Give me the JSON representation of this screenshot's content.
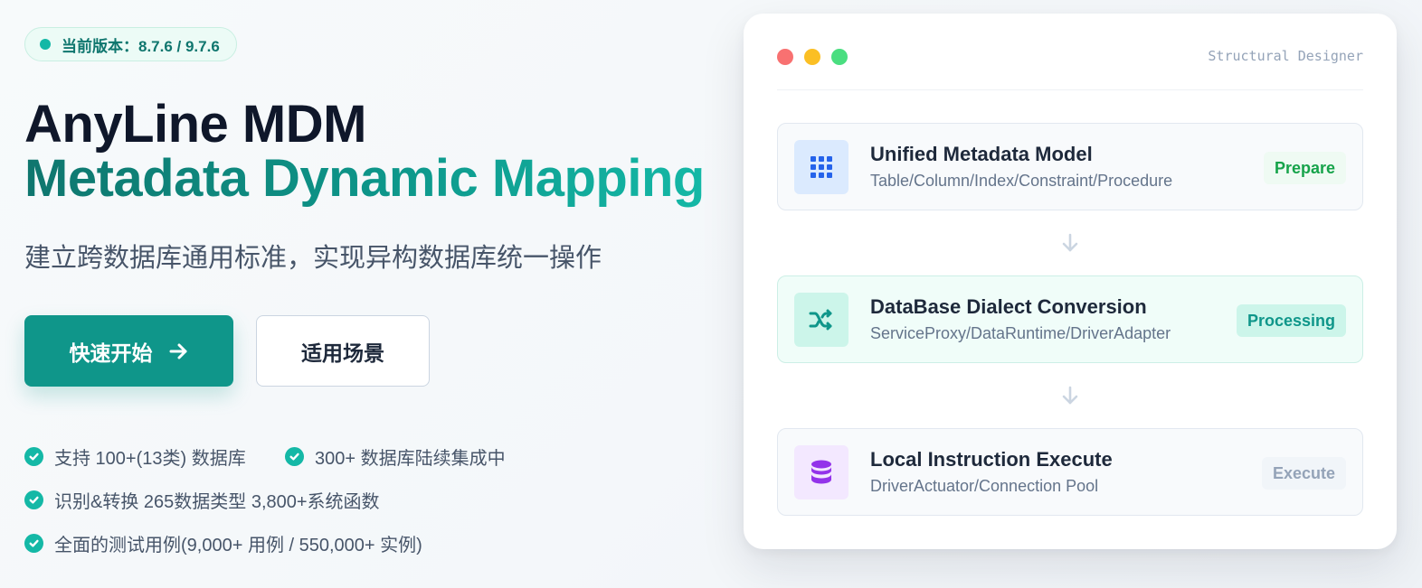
{
  "version_badge": {
    "text": "当前版本：8.7.6 / 9.7.6"
  },
  "hero": {
    "title_line1": "AnyLine MDM",
    "title_line2": "Metadata Dynamic Mapping",
    "subtitle": "建立跨数据库通用标准，实现异构数据库统一操作"
  },
  "actions": {
    "primary_label": "快速开始",
    "secondary_label": "适用场景"
  },
  "features": [
    "支持 100+(13类) 数据库",
    "300+ 数据库陆续集成中",
    "识别&转换 265数据类型 3,800+系统函数",
    "全面的测试用例(9,000+ 用例 / 550,000+ 实例)"
  ],
  "card": {
    "title": "Structural Designer",
    "steps": [
      {
        "title": "Unified Metadata Model",
        "subtitle": "Table/Column/Index/Constraint/Procedure",
        "tag": "Prepare",
        "icon": "grid-icon",
        "icon_color": "#2563eb",
        "icon_bg": "#dbeafe"
      },
      {
        "title": "DataBase Dialect Conversion",
        "subtitle": "ServiceProxy/DataRuntime/DriverAdapter",
        "tag": "Processing",
        "icon": "shuffle-icon",
        "icon_color": "#0f968a",
        "icon_bg": "#ccf5ea"
      },
      {
        "title": "Local Instruction Execute",
        "subtitle": "DriverActuator/Connection Pool",
        "tag": "Execute",
        "icon": "database-icon",
        "icon_color": "#9333ea",
        "icon_bg": "#f3e8ff"
      }
    ]
  },
  "colors": {
    "accent": "#0f968a",
    "accent_light": "#14b8a6",
    "heading": "#0f172a",
    "muted": "#475569"
  }
}
